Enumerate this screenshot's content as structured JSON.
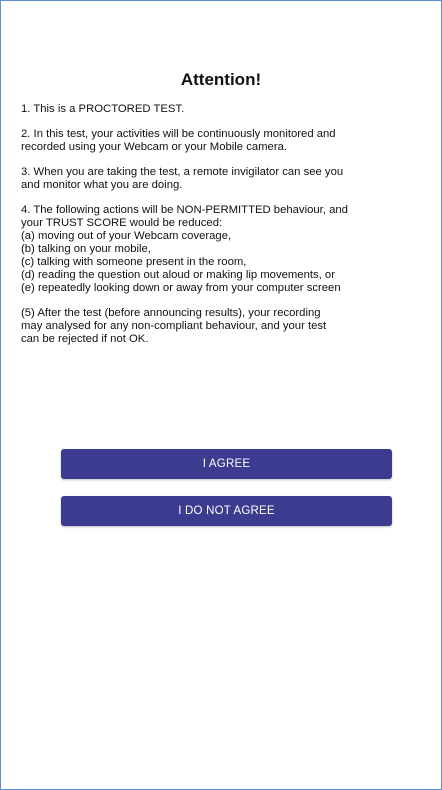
{
  "dialog": {
    "title": "Attention!",
    "paragraphs": [
      [
        "1. This is a PROCTORED TEST."
      ],
      [
        "2. In this test, your activities will be continuously monitored and",
        "recorded using your Webcam or your Mobile camera."
      ],
      [
        "3. When you are taking the test, a remote invigilator can see you",
        "and monitor what you are doing."
      ],
      [
        "4. The following actions will be NON-PERMITTED behaviour, and",
        "your TRUST SCORE would be reduced:",
        "(a) moving out of your Webcam coverage,",
        "(b) talking on your mobile,",
        "(c) talking with someone present in the room,",
        "(d) reading the question out aloud or making lip movements, or",
        "(e) repeatedly looking down or away from your computer screen"
      ],
      [
        "(5) After the test (before announcing results), your recording",
        "may analysed for any non-compliant behaviour, and your test",
        "can be rejected if not OK."
      ]
    ],
    "agree_label": "I AGREE",
    "disagree_label": "I DO NOT AGREE"
  },
  "colors": {
    "button_bg": "#3b3b8f",
    "button_text": "#ffffff",
    "frame_border": "#5b8fd6"
  }
}
